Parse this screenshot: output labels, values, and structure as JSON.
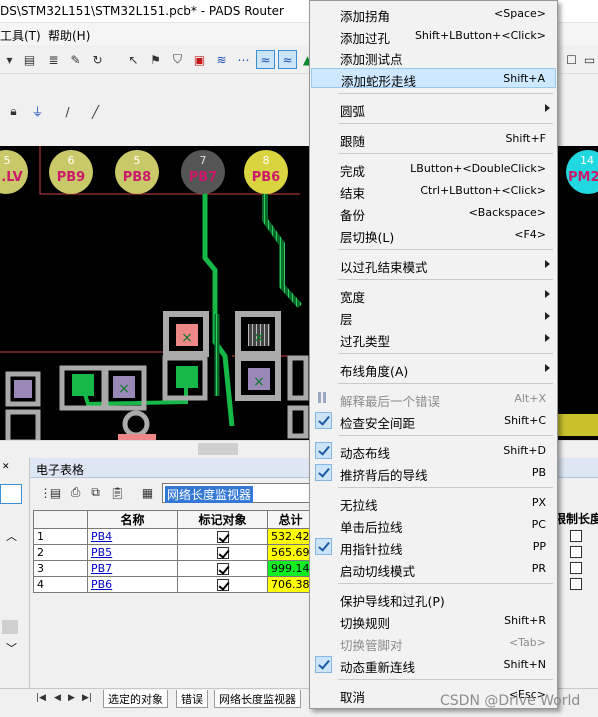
{
  "window": {
    "title": "DS\\STM32L151\\STM32L151.pcb* - PADS Router"
  },
  "menubar": {
    "tools": "工具(T)",
    "help": "帮助(H)"
  },
  "pcb": {
    "pins": [
      {
        "label": "5",
        "net": ".LV"
      },
      {
        "label": "6",
        "net": "PB9"
      },
      {
        "label": "5",
        "net": "PB8"
      },
      {
        "label": "7",
        "net": "PB7"
      },
      {
        "label": "8",
        "net": "PB6"
      },
      {
        "label": "14",
        "net": "PM2"
      }
    ]
  },
  "spreadsheet": {
    "panel_title": "电子表格",
    "monitor_combo": "网络长度监视器",
    "columns": {
      "name": "名称",
      "mark": "标记对象",
      "length": "总计",
      "right": "限制长度"
    },
    "rows": [
      {
        "index": "1",
        "name": "PB4",
        "marked": true,
        "length": "532.42",
        "color": "#ffff00"
      },
      {
        "index": "2",
        "name": "PB5",
        "marked": true,
        "length": "565.69",
        "color": "#ffff00"
      },
      {
        "index": "3",
        "name": "PB7",
        "marked": true,
        "length": "999.14",
        "color": "#11ee22"
      },
      {
        "index": "4",
        "name": "PB6",
        "marked": true,
        "length": "706.38",
        "color": "#ffff00"
      }
    ]
  },
  "tabs": {
    "items": [
      "选定的对象",
      "错误",
      "网络长度监视器"
    ]
  },
  "context_menu": {
    "items": [
      {
        "label": "添加拐角",
        "shortcut": "<Space>"
      },
      {
        "label": "添加过孔",
        "shortcut": "Shift+LButton+<Click>"
      },
      {
        "label": "添加测试点",
        "shortcut": ""
      },
      {
        "label": "添加蛇形走线",
        "shortcut": "Shift+A",
        "highlighted": true
      },
      {
        "label": "圆弧",
        "submenu": true
      },
      {
        "label": "跟随",
        "shortcut": "Shift+F"
      },
      {
        "label": "完成",
        "shortcut": "LButton+<DoubleClick>"
      },
      {
        "label": "结束",
        "shortcut": "Ctrl+LButton+<Click>"
      },
      {
        "label": "备份",
        "shortcut": "<Backspace>"
      },
      {
        "label": "层切换(L)",
        "shortcut": "<F4>"
      },
      {
        "label": "以过孔结束模式",
        "submenu": true
      },
      {
        "label": "宽度",
        "submenu": true
      },
      {
        "label": "层",
        "submenu": true
      },
      {
        "label": "过孔类型",
        "submenu": true
      },
      {
        "label": "布线角度(A)",
        "submenu": true
      },
      {
        "label": "解释最后一个错误",
        "shortcut": "Alt+X",
        "disabled": true
      },
      {
        "label": "检查安全间距",
        "shortcut": "Shift+C",
        "checked": true
      },
      {
        "label": "动态布线",
        "shortcut": "Shift+D",
        "checked": true
      },
      {
        "label": "推挤背后的导线",
        "shortcut": "PB",
        "checked": true
      },
      {
        "label": "无拉线",
        "shortcut": "PX"
      },
      {
        "label": "单击后拉线",
        "shortcut": "PC"
      },
      {
        "label": "用指针拉线",
        "shortcut": "PP",
        "checked": true
      },
      {
        "label": "启动切线模式",
        "shortcut": "PR"
      },
      {
        "label": "保护导线和过孔(P)",
        "shortcut": ""
      },
      {
        "label": "切换规则",
        "shortcut": "Shift+R"
      },
      {
        "label": "切换管脚对",
        "shortcut": "<Tab>",
        "disabled": true
      },
      {
        "label": "动态重新连线",
        "shortcut": "Shift+N",
        "checked": true
      },
      {
        "label": "取消",
        "shortcut": "<Esc>"
      }
    ]
  },
  "watermark": "CSDN @Drive World"
}
